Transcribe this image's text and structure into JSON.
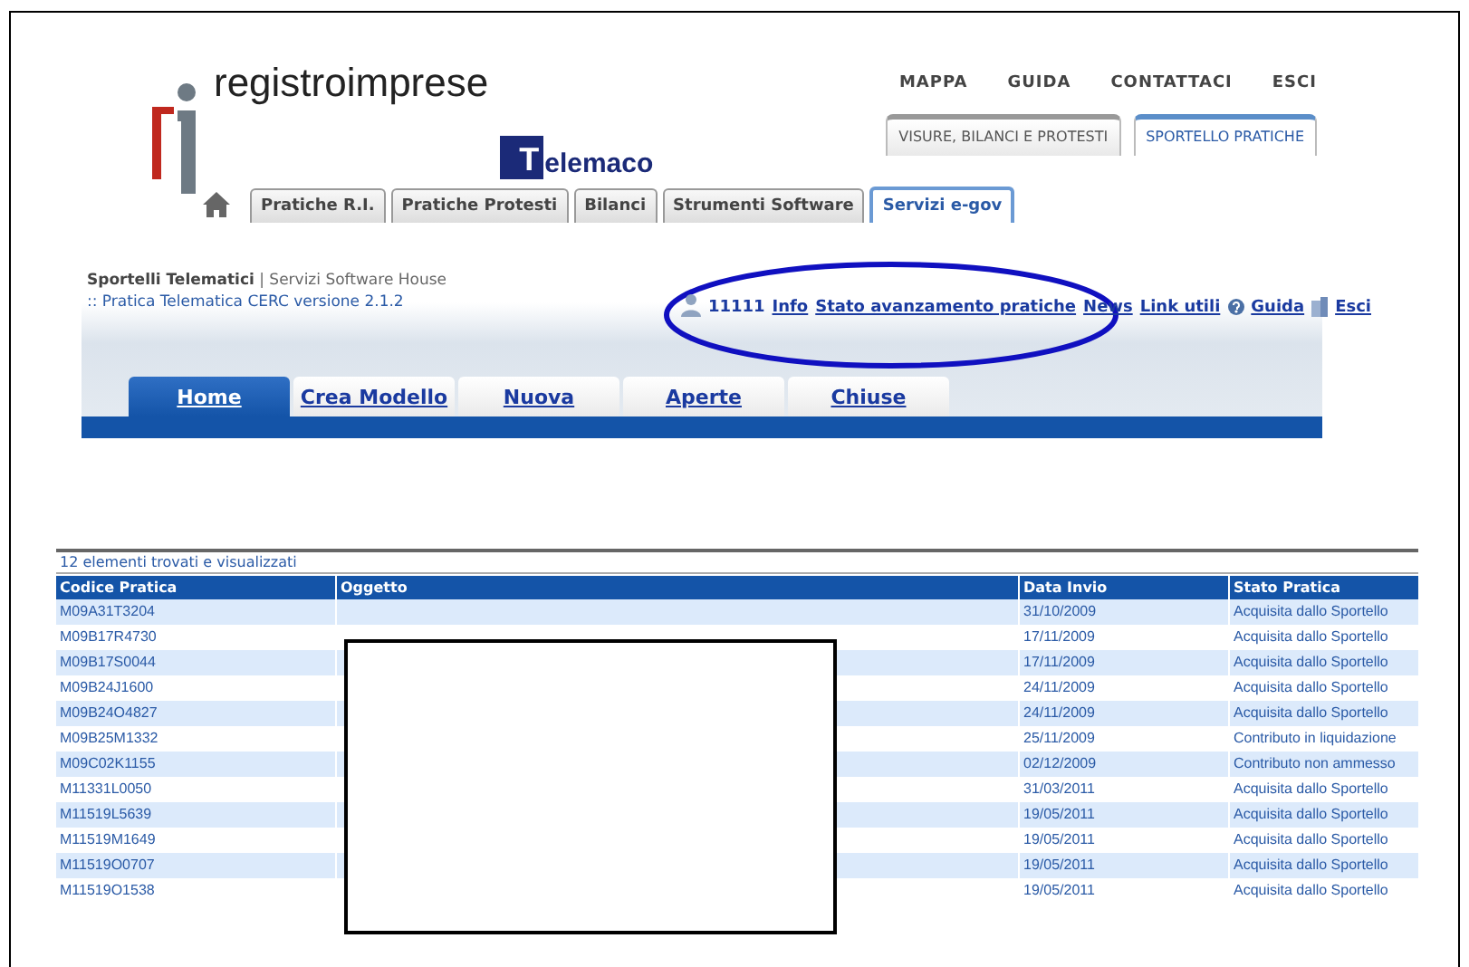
{
  "logo": {
    "name": "registroimprese",
    "mark": "T",
    "brand": "elemaco"
  },
  "top_links": [
    "MAPPA",
    "GUIDA",
    "CONTATTACI",
    "ESCI"
  ],
  "section_tabs": [
    {
      "label": "VISURE, BILANCI E PROTESTI",
      "selected": false
    },
    {
      "label": "SPORTELLO PRATICHE",
      "selected": true
    }
  ],
  "main_tabs": [
    {
      "label": "Pratiche R.I.",
      "selected": false
    },
    {
      "label": "Pratiche Protesti",
      "selected": false
    },
    {
      "label": "Bilanci",
      "selected": false
    },
    {
      "label": "Strumenti Software",
      "selected": false
    },
    {
      "label": "Servizi e-gov",
      "selected": true
    }
  ],
  "breadcrumb": "**Sportelli Telematici** | Servizi Software House",
  "version": ":: Pratica Telematica CERC versione 2.1.2",
  "user": "11111",
  "user_links": [
    {
      "label": "Info",
      "kind": "plain"
    },
    {
      "label": "Stato avanzamento pratiche",
      "kind": "plain"
    },
    {
      "label": "News",
      "kind": "plain"
    },
    {
      "label": "Link utili",
      "kind": "plain"
    },
    {
      "label": "Guida",
      "kind": "help"
    },
    {
      "label": "Esci",
      "kind": "exit"
    }
  ],
  "nav_tabs": [
    {
      "label": "Home",
      "selected": true
    },
    {
      "label": "Crea Modello",
      "selected": false
    },
    {
      "label": "Nuova",
      "selected": false
    },
    {
      "label": "Aperte",
      "selected": false
    },
    {
      "label": "Chiuse",
      "selected": false
    }
  ],
  "table": {
    "count": "12 elementi trovati e visualizzati",
    "columns": [
      "Codice Pratica",
      "Oggetto",
      "Data Invio",
      "Stato Pratica"
    ],
    "rows": [
      {
        "codice": "M09A31T3204",
        "data": "31/10/2009",
        "stato": "Acquisita dallo Sportello"
      },
      {
        "codice": "M09B17R4730",
        "data": "17/11/2009",
        "stato": "Acquisita dallo Sportello"
      },
      {
        "codice": "M09B17S0044",
        "data": "17/11/2009",
        "stato": "Acquisita dallo Sportello"
      },
      {
        "codice": "M09B24J1600",
        "data": "24/11/2009",
        "stato": "Acquisita dallo Sportello"
      },
      {
        "codice": "M09B24O4827",
        "data": "24/11/2009",
        "stato": "Acquisita dallo Sportello"
      },
      {
        "codice": "M09B25M1332",
        "data": "25/11/2009",
        "stato": "Contributo in liquidazione"
      },
      {
        "codice": "M09C02K1155",
        "data": "02/12/2009",
        "stato": "Contributo non ammesso"
      },
      {
        "codice": "M11331L0050",
        "data": "31/03/2011",
        "stato": "Acquisita dallo Sportello"
      },
      {
        "codice": "M11519L5639",
        "data": "19/05/2011",
        "stato": "Acquisita dallo Sportello"
      },
      {
        "codice": "M11519M1649",
        "data": "19/05/2011",
        "stato": "Acquisita dallo Sportello"
      },
      {
        "codice": "M11519O0707",
        "data": "19/05/2011",
        "stato": "Acquisita dallo Sportello"
      },
      {
        "codice": "M11519O1538",
        "data": "19/05/2011",
        "stato": "Acquisita dallo Sportello"
      }
    ]
  }
}
